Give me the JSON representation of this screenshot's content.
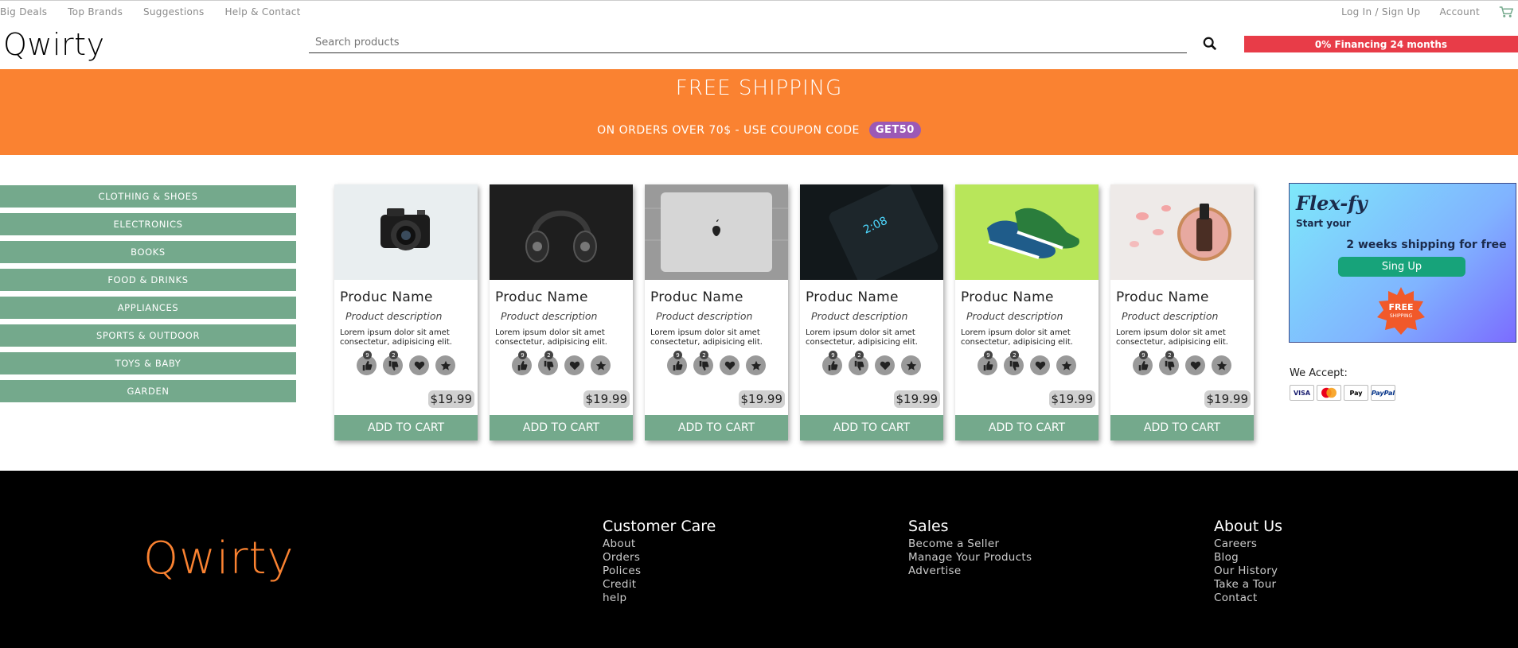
{
  "topbar": {
    "left_links": [
      "Big Deals",
      "Top Brands",
      "Suggestions",
      "Help & Contact"
    ],
    "login": "Log In / Sign Up",
    "account": "Account"
  },
  "header": {
    "logo": "Qwirty",
    "search_placeholder": "Search products",
    "financing": "0% Financing 24 months"
  },
  "banner": {
    "title": "FREE SHIPPING",
    "subtitle": "ON ORDERS OVER 70$ - USE COUPON CODE",
    "coupon": "GET50"
  },
  "sidebar": {
    "categories": [
      "CLOTHING & SHOES",
      "ELECTRONICS",
      "BOOKS",
      "FOOD & DRINKS",
      "APPLIANCES",
      "SPORTS & OUTDOOR",
      "TOYS & BABY",
      "GARDEN"
    ]
  },
  "products": [
    {
      "name": "Produc Name",
      "description": "Product description",
      "lorem": "Lorem ipsum dolor sit amet consectetur, adipisicing elit.",
      "likes": "9",
      "dislikes": "2",
      "price": "$19.99",
      "add_label": "ADD TO CART",
      "image": "camera"
    },
    {
      "name": "Produc Name",
      "description": "Product description",
      "lorem": "Lorem ipsum dolor sit amet consectetur, adipisicing elit.",
      "likes": "9",
      "dislikes": "2",
      "price": "$19.99",
      "add_label": "ADD TO CART",
      "image": "headphones"
    },
    {
      "name": "Produc Name",
      "description": "Product description",
      "lorem": "Lorem ipsum dolor sit amet consectetur, adipisicing elit.",
      "likes": "9",
      "dislikes": "2",
      "price": "$19.99",
      "add_label": "ADD TO CART",
      "image": "laptop"
    },
    {
      "name": "Produc Name",
      "description": "Product description",
      "lorem": "Lorem ipsum dolor sit amet consectetur, adipisicing elit.",
      "likes": "9",
      "dislikes": "2",
      "price": "$19.99",
      "add_label": "ADD TO CART",
      "image": "phone"
    },
    {
      "name": "Produc Name",
      "description": "Product description",
      "lorem": "Lorem ipsum dolor sit amet consectetur, adipisicing elit.",
      "likes": "9",
      "dislikes": "2",
      "price": "$19.99",
      "add_label": "ADD TO CART",
      "image": "sneakers"
    },
    {
      "name": "Produc Name",
      "description": "Product description",
      "lorem": "Lorem ipsum dolor sit amet consectetur, adipisicing elit.",
      "likes": "9",
      "dislikes": "2",
      "price": "$19.99",
      "add_label": "ADD TO CART",
      "image": "bottle"
    }
  ],
  "ad": {
    "brand": "Flex-fy",
    "start": "Start your",
    "headline": "2 weeks shipping for free",
    "button": "Sing Up",
    "star_line1": "FREE",
    "star_line2": "SHIPPING"
  },
  "payment": {
    "label": "We Accept:",
    "methods": [
      "VISA",
      "MC",
      "Pay",
      "PayPal"
    ]
  },
  "footer": {
    "logo": "Qwirty",
    "columns": [
      {
        "title": "Customer Care",
        "links": [
          "About",
          "Orders",
          "Polices",
          "Credit",
          "help"
        ]
      },
      {
        "title": "Sales",
        "links": [
          "Become a Seller",
          "Manage Your Products",
          "Advertise"
        ]
      },
      {
        "title": "About Us",
        "links": [
          "Careers",
          "Blog",
          "Our History",
          "Take a Tour",
          "Contact"
        ]
      }
    ]
  },
  "colors": {
    "accent": "#fa8231",
    "category_green": "#74a98c",
    "financing_red": "#e83c48",
    "coupon_purple": "#9b59b6"
  }
}
